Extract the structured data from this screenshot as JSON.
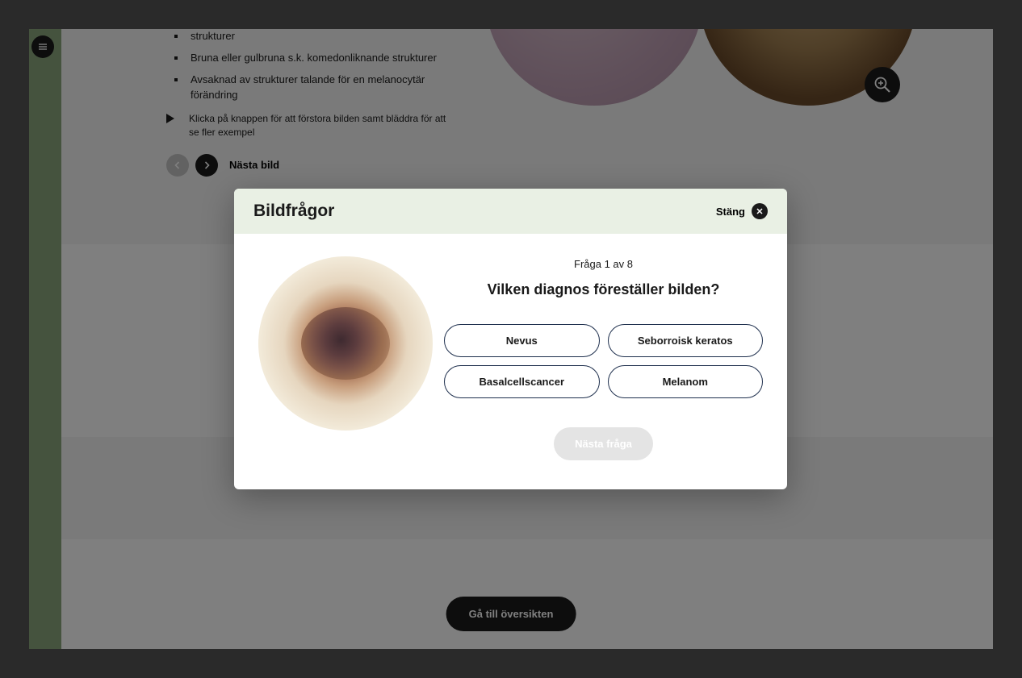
{
  "background": {
    "bullets": [
      "strukturer",
      "Bruna eller gulbruna s.k. komedonliknande strukturer",
      "Avsaknad av strukturer talande för en melanocytär förändring"
    ],
    "hint": "Klicka på knappen för att förstora bilden samt bläddra för att se fler exempel",
    "next_image_label": "Nästa bild",
    "footer_button": "Gå till översikten"
  },
  "modal": {
    "title": "Bildfrågor",
    "close_label": "Stäng",
    "counter": "Fråga 1 av 8",
    "question": "Vilken diagnos föreställer bilden?",
    "options": [
      "Nevus",
      "Seborroisk keratos",
      "Basalcellscancer",
      "Melanom"
    ],
    "next_question_label": "Nästa fråga"
  }
}
